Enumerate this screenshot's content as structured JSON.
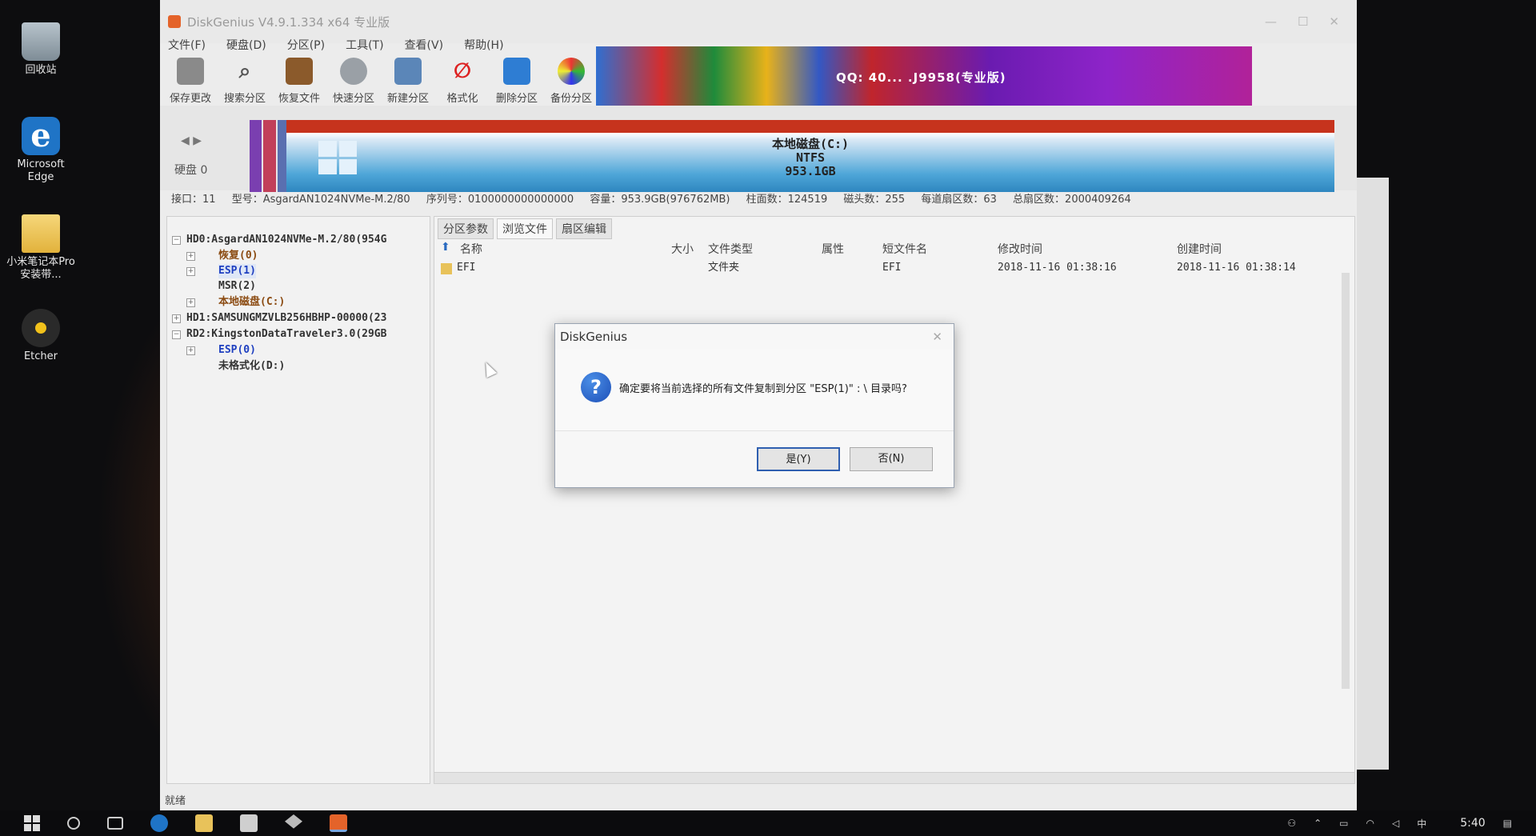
{
  "desktop": {
    "icons": [
      {
        "label": "回收站",
        "icon": "recycle-bin-icon"
      },
      {
        "label": "Microsoft Edge",
        "icon": "edge-icon"
      },
      {
        "label": "小米笔记本Pro安装带...",
        "icon": "folder-icon"
      },
      {
        "label": "Etcher",
        "icon": "etcher-icon"
      }
    ]
  },
  "window": {
    "title": "DiskGenius V4.9.1.334 x64 专业版",
    "menu": [
      "文件(F)",
      "硬盘(D)",
      "分区(P)",
      "工具(T)",
      "查看(V)",
      "帮助(H)"
    ],
    "toolbar": [
      "保存更改",
      "搜索分区",
      "恢复文件",
      "快速分区",
      "新建分区",
      "格式化",
      "删除分区",
      "备份分区"
    ],
    "banner_text": "QQ: 40... .J9958(专业版)",
    "disk_map": {
      "disk_label": "硬盘 0",
      "partition_name": "本地磁盘(C:)",
      "fs": "NTFS",
      "size": "953.1GB"
    },
    "disk_info": {
      "interface": "接口：11",
      "model": "型号：AsgardAN1024NVMe-M.2/80",
      "serial": "序列号：0100000000000000",
      "capacity": "容量：953.9GB(976762MB)",
      "cylinders": "柱面数：124519",
      "heads": "磁头数：255",
      "sectors_per_track": "每道扇区数：63",
      "total_sectors": "总扇区数：2000409264"
    },
    "tree": [
      "HD0:AsgardAN1024NVMe-M.2/80(954G",
      "恢复(0)",
      "ESP(1)",
      "MSR(2)",
      "本地磁盘(C:)",
      "HD1:SAMSUNGMZVLB256HBHP-00000(23",
      "RD2:KingstonDataTraveler3.0(29GB",
      "ESP(0)",
      "未格式化(D:)"
    ],
    "tabs": [
      "分区参数",
      "浏览文件",
      "扇区编辑"
    ],
    "columns": [
      "名称",
      "大小",
      "文件类型",
      "属性",
      "短文件名",
      "修改时间",
      "创建时间"
    ],
    "rows": [
      {
        "name": "EFI",
        "size": "",
        "type": "文件夹",
        "attr": "",
        "short": "EFI",
        "modified": "2018-11-16 01:38:16",
        "created": "2018-11-16 01:38:14"
      }
    ],
    "status": "就绪"
  },
  "dialog": {
    "title": "DiskGenius",
    "message": "确定要将当前选择的所有文件复制到分区 \"ESP(1)\" : \\ 目录吗?",
    "yes": "是(Y)",
    "no": "否(N)"
  },
  "taskbar": {
    "time": "5:40",
    "ime": "中"
  }
}
